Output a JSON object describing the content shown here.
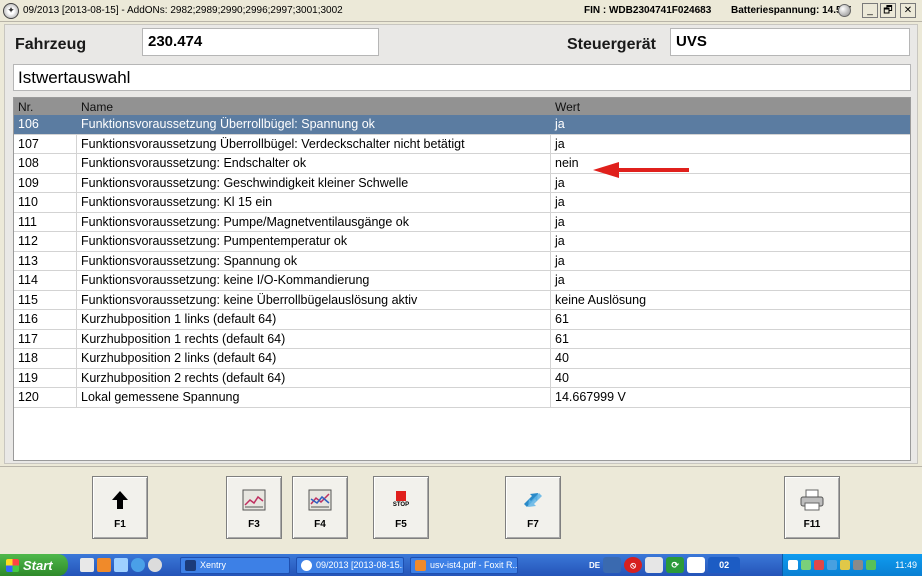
{
  "window": {
    "title": "09/2013 [2013-08-15] - AddONs: 2982;2989;2990;2996;2997;3001;3002",
    "fin": "FIN : WDB2304741F024683",
    "battery": "Batteriespannung: 14.5 V",
    "minimize": "_",
    "restore": "🗗",
    "close": "✕"
  },
  "header": {
    "fahrzeug_label": "Fahrzeug",
    "fahrzeug_value": "230.474",
    "steuergeraet_label": "Steuergerät",
    "steuergeraet_value": "UVS",
    "section_title": "Istwertauswahl"
  },
  "table": {
    "columns": {
      "nr": "Nr.",
      "name": "Name",
      "wert": "Wert"
    },
    "rows": [
      {
        "nr": "106",
        "name": "Funktionsvoraussetzung Überrollbügel: Spannung ok",
        "wert": "ja"
      },
      {
        "nr": "107",
        "name": "Funktionsvoraussetzung Überrollbügel: Verdeckschalter nicht betätigt",
        "wert": "ja"
      },
      {
        "nr": "108",
        "name": "Funktionsvoraussetzung: Endschalter ok",
        "wert": "nein"
      },
      {
        "nr": "109",
        "name": "Funktionsvoraussetzung: Geschwindigkeit kleiner Schwelle",
        "wert": "ja"
      },
      {
        "nr": "110",
        "name": "Funktionsvoraussetzung: Kl 15 ein",
        "wert": "ja"
      },
      {
        "nr": "111",
        "name": "Funktionsvoraussetzung: Pumpe/Magnetventilausgänge ok",
        "wert": "ja"
      },
      {
        "nr": "112",
        "name": "Funktionsvoraussetzung: Pumpentemperatur ok",
        "wert": "ja"
      },
      {
        "nr": "113",
        "name": "Funktionsvoraussetzung: Spannung ok",
        "wert": "ja"
      },
      {
        "nr": "114",
        "name": "Funktionsvoraussetzung: keine I/O-Kommandierung",
        "wert": "ja"
      },
      {
        "nr": "115",
        "name": "Funktionsvoraussetzung: keine Überrollbügelauslösung aktiv",
        "wert": "keine Auslösung"
      },
      {
        "nr": "116",
        "name": "Kurzhubposition 1 links (default 64)",
        "wert": "61"
      },
      {
        "nr": "117",
        "name": "Kurzhubposition 1 rechts (default 64)",
        "wert": "61"
      },
      {
        "nr": "118",
        "name": "Kurzhubposition 2 links (default 64)",
        "wert": "40"
      },
      {
        "nr": "119",
        "name": "Kurzhubposition 2 rechts (default 64)",
        "wert": "40"
      },
      {
        "nr": "120",
        "name": "Lokal gemessene Spannung",
        "wert": "14.667999 V"
      }
    ],
    "selected_row": "106",
    "highlight_color": "#5b7ca1",
    "annotation_arrow_color": "#e0201c"
  },
  "function_keys": [
    {
      "key": "F1",
      "icon": "arrow-up-icon"
    },
    {
      "key": "F3",
      "icon": "chart-icon"
    },
    {
      "key": "F4",
      "icon": "chart-multi-icon"
    },
    {
      "key": "F5",
      "icon": "stop-icon",
      "icon_text": "STOP"
    },
    {
      "key": "F7",
      "icon": "swap-arrows-icon"
    },
    {
      "key": "F11",
      "icon": "printer-icon"
    }
  ],
  "taskbar": {
    "start": "Start",
    "tasks": [
      {
        "label": "Xentry",
        "icon": "xentry-icon"
      },
      {
        "label": "09/2013 [2013-08-15...",
        "icon": "mercedes-icon"
      },
      {
        "label": "usv-ist4.pdf - Foxit R...",
        "icon": "pdf-icon"
      }
    ],
    "language": "DE",
    "badge": "02",
    "clock": "11:49"
  }
}
